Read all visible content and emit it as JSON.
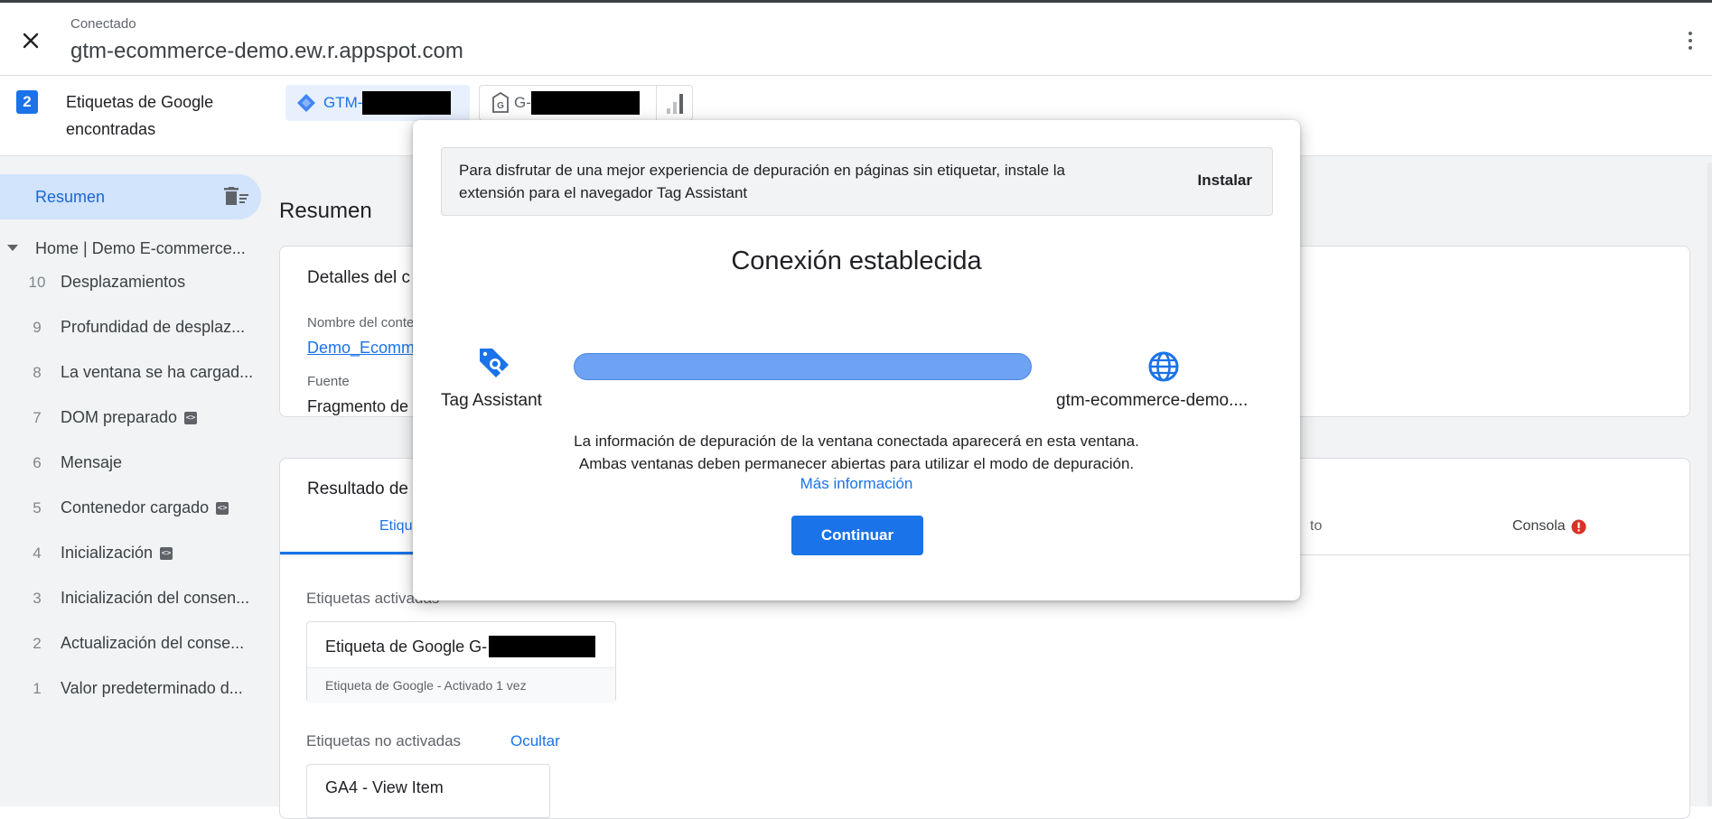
{
  "header": {
    "status": "Conectado",
    "url": "gtm-ecommerce-demo.ew.r.appspot.com"
  },
  "tags_bar": {
    "count": "2",
    "label": "Etiquetas de Google encontradas",
    "gtm_chip": "GTM-",
    "ga_chip": "G-"
  },
  "sidebar": {
    "summary_label": "Resumen",
    "page_label": "Home | Demo E-commerce...",
    "events": [
      {
        "num": "10",
        "label": "Desplazamientos",
        "code": false
      },
      {
        "num": "9",
        "label": "Profundidad de desplaz...",
        "code": false
      },
      {
        "num": "8",
        "label": "La ventana se ha cargad...",
        "code": false
      },
      {
        "num": "7",
        "label": "DOM preparado",
        "code": true
      },
      {
        "num": "6",
        "label": "Mensaje",
        "code": false
      },
      {
        "num": "5",
        "label": "Contenedor cargado",
        "code": true
      },
      {
        "num": "4",
        "label": "Inicialización",
        "code": true
      },
      {
        "num": "3",
        "label": "Inicialización del consen...",
        "code": false
      },
      {
        "num": "2",
        "label": "Actualización del conse...",
        "code": false
      },
      {
        "num": "1",
        "label": "Valor predeterminado d...",
        "code": false
      }
    ]
  },
  "main": {
    "title": "Resumen",
    "details_card": {
      "title": "Detalles del c",
      "name_label": "Nombre del conte",
      "name_value": "Demo_Ecomme",
      "source_label": "Fuente",
      "source_value": "Fragmento de g"
    },
    "results_card": {
      "title": "Resultado de",
      "tabs": {
        "tags": "Etique",
        "partial": "to",
        "console": "Consola"
      },
      "fired_label": "Etiquetas activadas",
      "fired_tag_title": "Etiqueta de Google G-",
      "fired_tag_sub": "Etiqueta de Google - Activado 1 vez",
      "not_fired_label": "Etiquetas no activadas",
      "hide_link": "Ocultar",
      "not_fired_tag": "GA4 - View Item"
    }
  },
  "dialog": {
    "banner_text": "Para disfrutar de una mejor experiencia de depuración en páginas sin etiquetar, instale la extensión para el navegador Tag Assistant",
    "banner_button": "Instalar",
    "title": "Conexión establecida",
    "left_label": "Tag Assistant",
    "right_label": "gtm-ecommerce-demo....",
    "info_line1": "La información de depuración de la ventana conectada aparecerá en esta ventana.",
    "info_line2": "Ambas ventanas deben permanecer abiertas para utilizar el modo de depuración.",
    "more_link": "Más información",
    "continue_button": "Continuar"
  },
  "colors": {
    "accent": "#1a73e8",
    "connection_bar": "#6ea2f2",
    "console_error": "#d93025"
  }
}
